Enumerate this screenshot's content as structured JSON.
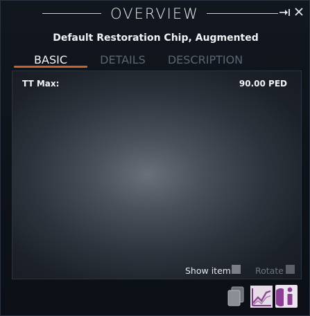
{
  "window": {
    "title": "OVERVIEW",
    "item_name": "Default Restoration Chip, Augmented"
  },
  "tabs": [
    {
      "label": "BASIC",
      "active": true
    },
    {
      "label": "DETAILS",
      "active": false
    },
    {
      "label": "DESCRIPTION",
      "active": false
    }
  ],
  "stats": {
    "tt_max_label": "TT Max:",
    "tt_max_value": "90.00 PED"
  },
  "options": {
    "show_item_label": "Show item",
    "show_item_checked": false,
    "rotate_label": "Rotate",
    "rotate_checked": false,
    "rotate_enabled": false
  },
  "colors": {
    "accent": "#c8642a",
    "button_tint": "#a050a8"
  },
  "icons": {
    "title_pin": "pin-icon",
    "title_close": "close-icon",
    "copy": "copy-icon",
    "chart": "chart-icon",
    "info": "info-icon"
  }
}
